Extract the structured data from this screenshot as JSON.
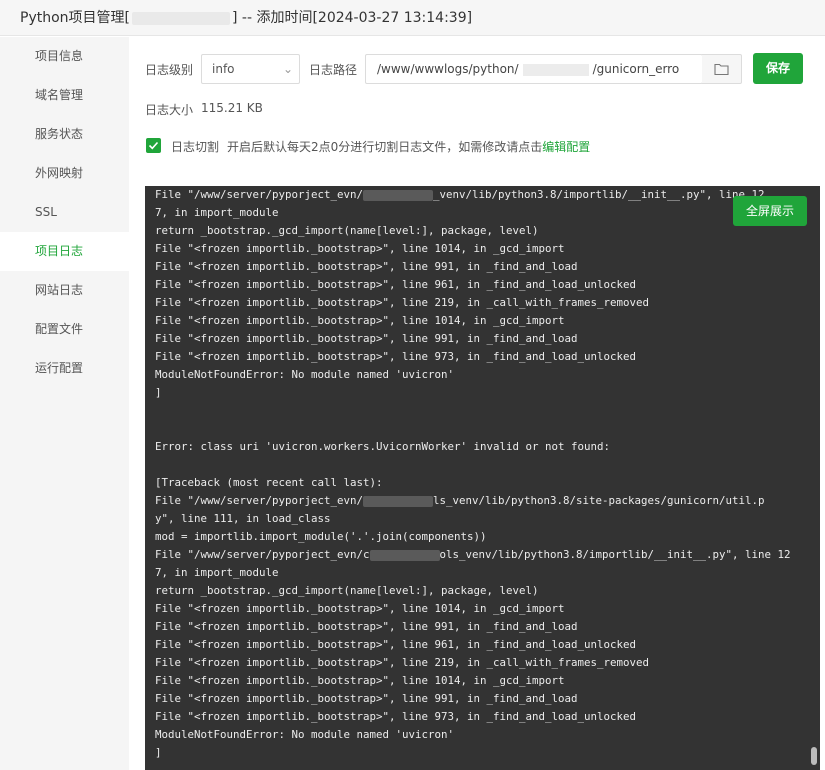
{
  "window": {
    "title_prefix": "Python项目管理[",
    "title_suffix": "] -- 添加时间[2024-03-27 13:14:39]"
  },
  "sidebar": {
    "items": [
      {
        "label": "项目信息"
      },
      {
        "label": "域名管理"
      },
      {
        "label": "服务状态"
      },
      {
        "label": "外网映射"
      },
      {
        "label": "SSL"
      },
      {
        "label": "项目日志"
      },
      {
        "label": "网站日志"
      },
      {
        "label": "配置文件"
      },
      {
        "label": "运行配置"
      }
    ],
    "active": "项目日志"
  },
  "log_settings": {
    "level_label": "日志级别",
    "level_value": "info",
    "path_label": "日志路径",
    "path_prefix": "/www/wwwlogs/python/",
    "path_suffix": "/gunicorn_erro",
    "save_label": "保存",
    "size_label": "日志大小",
    "size_value": "115.21 KB",
    "cut_label": "日志切割",
    "cut_desc": "开启后默认每天2点0分进行切割日志文件，如需修改请点击",
    "cut_link": "编辑配置",
    "cut_enabled": true
  },
  "console": {
    "fullscreen_label": "全屏展示",
    "lines": [
      {
        "pre": "File \"/www/server/pyporject_evn/",
        "post": "_venv/lib/python3.8/importlib/__init__.py\", line 12"
      },
      {
        "text": "7, in import_module"
      },
      {
        "text": "return _bootstrap._gcd_import(name[level:], package, level)"
      },
      {
        "text": "File \"<frozen importlib._bootstrap>\", line 1014, in _gcd_import"
      },
      {
        "text": "File \"<frozen importlib._bootstrap>\", line 991, in _find_and_load"
      },
      {
        "text": "File \"<frozen importlib._bootstrap>\", line 961, in _find_and_load_unlocked"
      },
      {
        "text": "File \"<frozen importlib._bootstrap>\", line 219, in _call_with_frames_removed"
      },
      {
        "text": "File \"<frozen importlib._bootstrap>\", line 1014, in _gcd_import"
      },
      {
        "text": "File \"<frozen importlib._bootstrap>\", line 991, in _find_and_load"
      },
      {
        "text": "File \"<frozen importlib._bootstrap>\", line 973, in _find_and_load_unlocked"
      },
      {
        "text": "ModuleNotFoundError: No module named 'uvicron'"
      },
      {
        "text": "]"
      },
      {
        "text": ""
      },
      {
        "text": ""
      },
      {
        "text": "Error: class uri 'uvicron.workers.UvicornWorker' invalid or not found:"
      },
      {
        "text": ""
      },
      {
        "text": "[Traceback (most recent call last):"
      },
      {
        "pre": "File \"/www/server/pyporject_evn/",
        "post": "ls_venv/lib/python3.8/site-packages/gunicorn/util.p"
      },
      {
        "text": "y\", line 111, in load_class"
      },
      {
        "text": "mod = importlib.import_module('.'.join(components))"
      },
      {
        "pre": "File \"/www/server/pyporject_evn/c",
        "post": "ols_venv/lib/python3.8/importlib/__init__.py\", line 12"
      },
      {
        "text": "7, in import_module"
      },
      {
        "text": "return _bootstrap._gcd_import(name[level:], package, level)"
      },
      {
        "text": "File \"<frozen importlib._bootstrap>\", line 1014, in _gcd_import"
      },
      {
        "text": "File \"<frozen importlib._bootstrap>\", line 991, in _find_and_load"
      },
      {
        "text": "File \"<frozen importlib._bootstrap>\", line 961, in _find_and_load_unlocked"
      },
      {
        "text": "File \"<frozen importlib._bootstrap>\", line 219, in _call_with_frames_removed"
      },
      {
        "text": "File \"<frozen importlib._bootstrap>\", line 1014, in _gcd_import"
      },
      {
        "text": "File \"<frozen importlib._bootstrap>\", line 991, in _find_and_load"
      },
      {
        "text": "File \"<frozen importlib._bootstrap>\", line 973, in _find_and_load_unlocked"
      },
      {
        "text": "ModuleNotFoundError: No module named 'uvicron'"
      },
      {
        "text": "]"
      }
    ]
  },
  "colors": {
    "accent": "#20a53a",
    "console_bg": "#333333",
    "console_text": "#ececec",
    "sidebar_bg": "#f5f5f5"
  }
}
